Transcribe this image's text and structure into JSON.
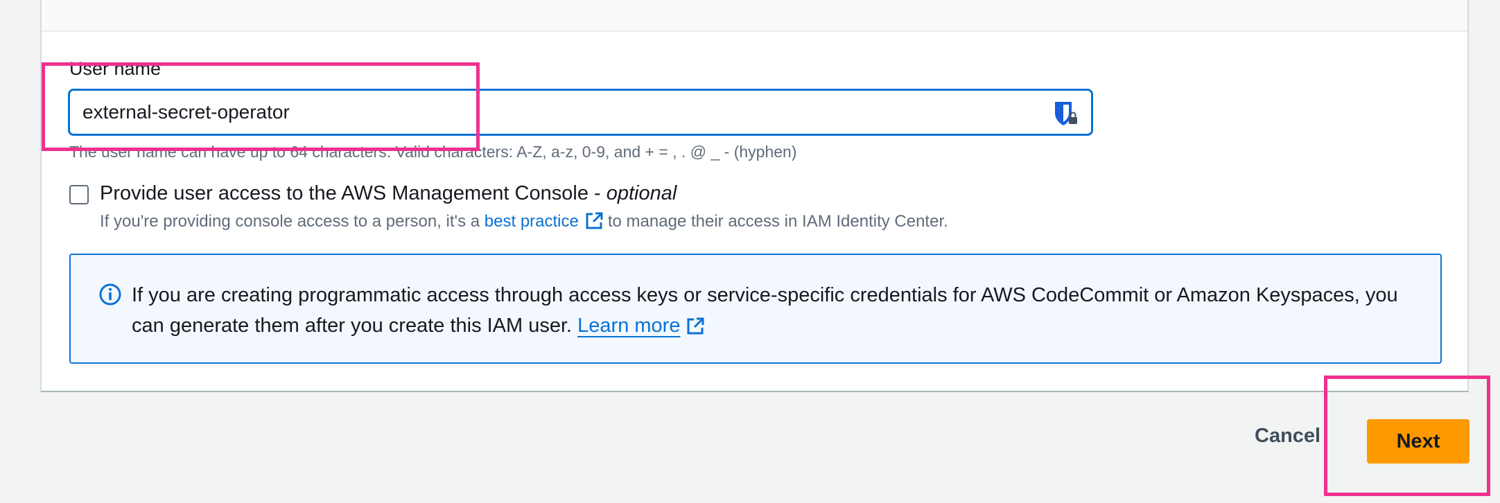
{
  "form": {
    "username_label": "User name",
    "username_value": "external-secret-operator",
    "username_constraint": "The user name can have up to 64 characters. Valid characters: A-Z, a-z, 0-9, and + = , . @ _ - (hyphen)",
    "console_access_title": "Provide user access to the AWS Management Console - ",
    "console_access_optional": "optional",
    "console_access_desc_before": "If you're providing console access to a person, it's a ",
    "console_access_link": "best practice",
    "console_access_desc_after": "to manage their access in IAM Identity Center.",
    "console_access_checked": false
  },
  "info": {
    "text": "If you are creating programmatic access through access keys or service-specific credentials for AWS CodeCommit or Amazon Keyspaces, you can generate them after you create this IAM user. ",
    "link": "Learn more"
  },
  "footer": {
    "cancel_label": "Cancel",
    "next_label": "Next"
  },
  "colors": {
    "accent": "#0972d3",
    "primary_button": "#ff9900",
    "highlight": "#f0308d"
  }
}
